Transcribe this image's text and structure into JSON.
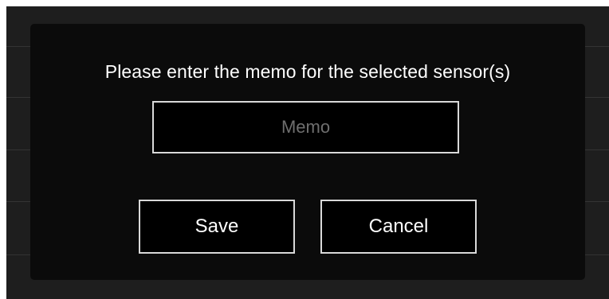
{
  "dialog": {
    "prompt": "Please enter the memo for the selected sensor(s)",
    "memo_input": {
      "value": "",
      "placeholder": "Memo"
    },
    "save_label": "Save",
    "cancel_label": "Cancel"
  },
  "colors": {
    "backdrop": "#1e1e1e",
    "modal_background": "#0b0b0b",
    "border": "#d9d9d9",
    "text": "#ffffff",
    "placeholder": "#6f6f6f"
  }
}
